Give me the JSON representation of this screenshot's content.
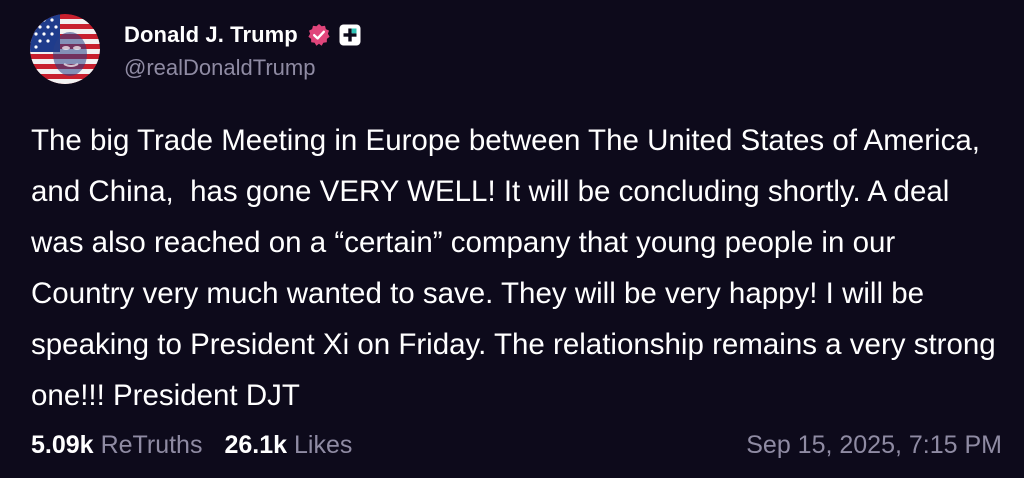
{
  "author": {
    "display_name": "Donald J. Trump",
    "handle": "@realDonaldTrump",
    "avatar_icon": "flag-portrait-avatar",
    "verified_icon": "verified-badge-icon",
    "plus_icon": "plus-badge-icon",
    "verified_color": "#e0457b"
  },
  "post": {
    "text": "The big Trade Meeting in Europe between The United States of America, and China,  has gone VERY WELL! It will be concluding shortly. A deal was also reached on a “certain” company that young people in our Country very much wanted to save. They will be very happy! I will be speaking to President Xi on Friday. The relationship remains a very strong one!!! President DJT"
  },
  "stats": {
    "retruths_count": "5.09k",
    "retruths_label": "ReTruths",
    "likes_count": "26.1k",
    "likes_label": "Likes",
    "timestamp": "Sep 15, 2025, 7:15 PM"
  },
  "colors": {
    "background": "#0d0a1b",
    "text": "#ffffff",
    "muted": "#8f8ba3"
  }
}
